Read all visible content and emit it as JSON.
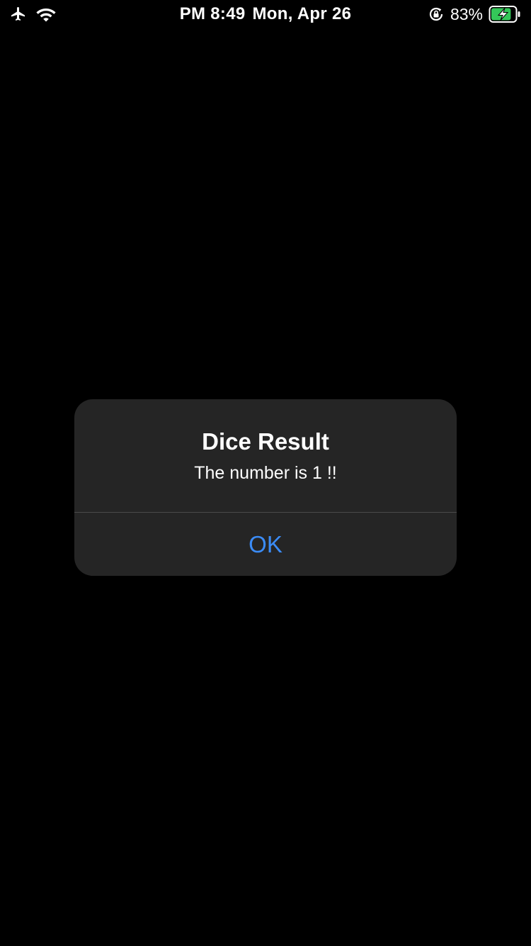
{
  "status_bar": {
    "time": "PM 8:49",
    "date": "Mon, Apr 26",
    "battery_percent": "83%",
    "battery_level": 0.83,
    "left_icons": [
      "airplane-icon",
      "wifi-icon"
    ],
    "right_icons": [
      "orientation-lock-icon",
      "battery-charging-icon"
    ],
    "battery_color": "#34c759"
  },
  "alert": {
    "title": "Dice Result",
    "message": "The number is 1 !!",
    "button_label": "OK",
    "button_color": "#3b8cf7",
    "background_color": "#252525"
  }
}
